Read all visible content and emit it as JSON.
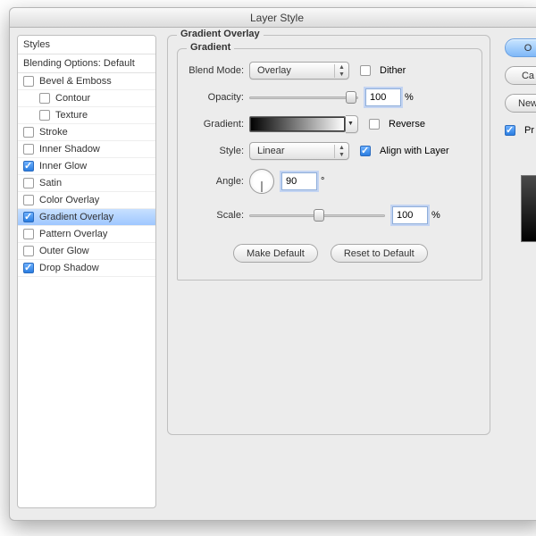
{
  "title": "Layer Style",
  "sidebar": {
    "header1": "Styles",
    "header2": "Blending Options: Default",
    "items": [
      {
        "label": "Bevel & Emboss",
        "checked": false,
        "indent": false
      },
      {
        "label": "Contour",
        "checked": false,
        "indent": true
      },
      {
        "label": "Texture",
        "checked": false,
        "indent": true
      },
      {
        "label": "Stroke",
        "checked": false,
        "indent": false
      },
      {
        "label": "Inner Shadow",
        "checked": false,
        "indent": false
      },
      {
        "label": "Inner Glow",
        "checked": true,
        "indent": false
      },
      {
        "label": "Satin",
        "checked": false,
        "indent": false
      },
      {
        "label": "Color Overlay",
        "checked": false,
        "indent": false
      },
      {
        "label": "Gradient Overlay",
        "checked": true,
        "indent": false,
        "selected": true
      },
      {
        "label": "Pattern Overlay",
        "checked": false,
        "indent": false
      },
      {
        "label": "Outer Glow",
        "checked": false,
        "indent": false
      },
      {
        "label": "Drop Shadow",
        "checked": true,
        "indent": false
      }
    ]
  },
  "panel": {
    "outerTitle": "Gradient Overlay",
    "innerTitle": "Gradient",
    "blendModeLabel": "Blend Mode:",
    "blendModeValue": "Overlay",
    "ditherLabel": "Dither",
    "opacityLabel": "Opacity:",
    "opacityValue": "100",
    "percent": "%",
    "gradientLabel": "Gradient:",
    "reverseLabel": "Reverse",
    "styleLabel": "Style:",
    "styleValue": "Linear",
    "alignLabel": "Align with Layer",
    "angleLabel": "Angle:",
    "angleValue": "90",
    "deg": "°",
    "scaleLabel": "Scale:",
    "scaleValue": "100",
    "makeDefault": "Make Default",
    "resetDefault": "Reset to Default"
  },
  "right": {
    "ok": "O",
    "cancel": "Ca",
    "newStyle": "New",
    "preview": "Pr"
  }
}
